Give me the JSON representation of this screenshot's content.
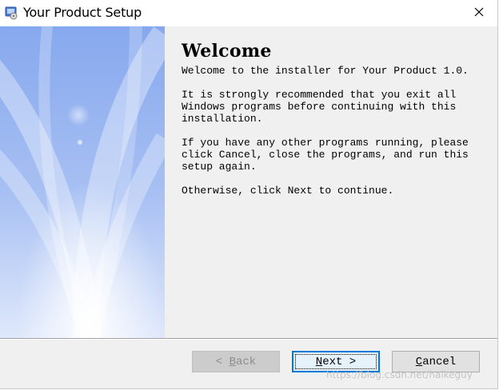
{
  "window": {
    "title": "Your Product Setup",
    "icon": "setup-installer-icon",
    "close_icon": "close-icon"
  },
  "content": {
    "heading": "Welcome",
    "paragraphs": [
      "Welcome to the installer for Your Product 1.0.",
      "It is strongly recommended that you exit all\nWindows programs before continuing with this\ninstallation.",
      "If you have any other programs running, please\nclick Cancel, close the programs, and run this\nsetup again.",
      "Otherwise, click Next to continue."
    ]
  },
  "buttons": {
    "back": {
      "label_prefix": "< ",
      "accel": "B",
      "label_rest": "ack",
      "enabled": false
    },
    "next": {
      "accel": "N",
      "label_rest": "ext >",
      "default": true
    },
    "cancel": {
      "accel": "C",
      "label_rest": "ancel"
    }
  },
  "watermark": "https://blog.csdn.net/haikeguy",
  "colors": {
    "panel_top": "#8fb0f0",
    "panel_bottom": "#d8e4fb",
    "dialog_bg": "#f0f0f0",
    "focus_border": "#0078d7"
  }
}
